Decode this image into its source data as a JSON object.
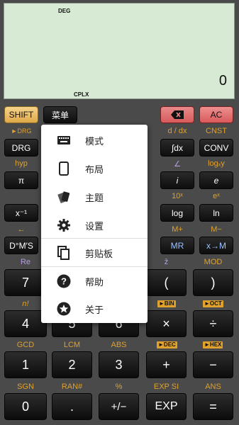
{
  "display": {
    "mode": "DEG",
    "value": "0",
    "complex": "CPLX"
  },
  "top_row": {
    "shift": "SHIFT",
    "menu": "菜单",
    "ac": "AC"
  },
  "labels": {
    "drg_shift": "►DRG",
    "ddx": "d / dx",
    "cnst": "CNST",
    "hyp": "hyp",
    "angle": "∠",
    "logxy": "logₓy",
    "ten_x": "10ˣ",
    "e_x": "eˣ",
    "arrow_left": "←",
    "m_plus": "M+",
    "m_minus": "M−",
    "re": "Re",
    "zbar": "z̄",
    "mod": "MOD",
    "nfact": "n!",
    "bin": "►BIN",
    "oct": "►OCT",
    "gcd": "GCD",
    "lcm": "LCM",
    "abs": "ABS",
    "dec": "►DEC",
    "hex": "►HEX",
    "sgn": "SGN",
    "ran": "RAN#",
    "pct": "%",
    "expsi": "EXP SI",
    "ans": "ANS"
  },
  "keys": {
    "drg": "DRG",
    "integral": "∫dx",
    "conv": "CONV",
    "pi": "π",
    "i": "i",
    "e": "e",
    "xinv": "x⁻¹",
    "log": "log",
    "ln": "ln",
    "dms": "D°M′S",
    "mr": "MR",
    "xm": "x→M",
    "n7": "7",
    "lparen": "(",
    "rparen": ")",
    "n4": "4",
    "n5": "5",
    "n6": "6",
    "mul": "×",
    "div": "÷",
    "n1": "1",
    "n2": "2",
    "n3": "3",
    "plus": "+",
    "minus": "−",
    "n0": "0",
    "dot": ".",
    "pm": "+/−",
    "exp": "EXP",
    "eq": "="
  },
  "menu": [
    {
      "label": "模式",
      "icon": "keyboard-icon"
    },
    {
      "label": "布局",
      "icon": "phone-icon"
    },
    {
      "label": "主题",
      "icon": "theme-cards-icon"
    },
    {
      "label": "设置",
      "icon": "gear-icon"
    },
    {
      "label": "剪贴板",
      "icon": "copy-icon"
    },
    {
      "label": "帮助",
      "icon": "help-icon"
    },
    {
      "label": "关于",
      "icon": "star-badge-icon"
    }
  ]
}
